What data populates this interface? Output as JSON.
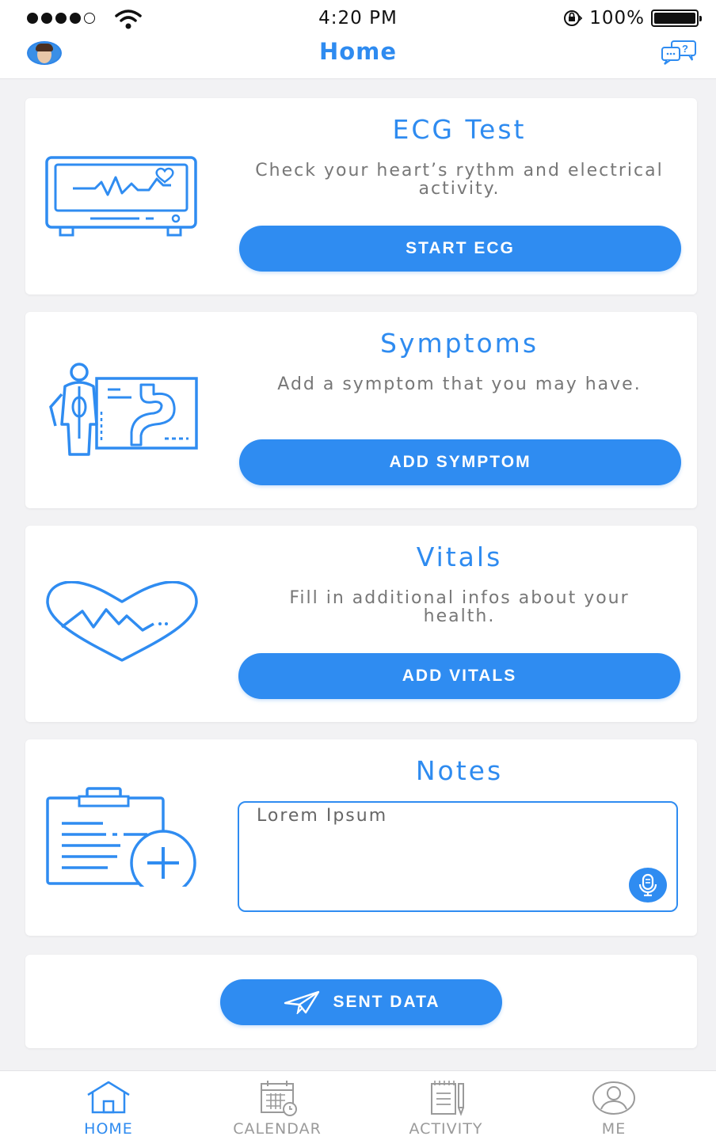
{
  "status_bar": {
    "time": "4:20 PM",
    "battery": "100%",
    "signal_bars": 4,
    "icons": [
      "signal-icon",
      "wifi-icon",
      "rotation-lock-icon",
      "battery-icon"
    ]
  },
  "nav": {
    "title": "Home",
    "left_icon": "avatar",
    "right_icon": "help-chat-icon"
  },
  "cards": [
    {
      "icon": "ecg-monitor-icon",
      "title": "ECG Test",
      "description": "Check your heart’s rythm and electrical activity.",
      "button": "START ECG"
    },
    {
      "icon": "symptoms-body-icon",
      "title": "Symptoms",
      "description": "Add a symptom that you may have.",
      "button": "ADD SYMPTOM"
    },
    {
      "icon": "vitals-heart-icon",
      "title": "Vitals",
      "description": "Fill in additional infos about your health.",
      "button": "ADD VITALS"
    }
  ],
  "notes": {
    "icon": "clipboard-add-icon",
    "title": "Notes",
    "text": "Lorem Ipsum",
    "mic_icon": "microphone-icon"
  },
  "send": {
    "icon": "paper-plane-icon",
    "label": "SENT DATA"
  },
  "tabs": [
    {
      "label": "HOME",
      "icon": "home-icon",
      "active": true
    },
    {
      "label": "CALENDAR",
      "icon": "calendar-icon",
      "active": false
    },
    {
      "label": "ACTIVITY",
      "icon": "activity-icon",
      "active": false
    },
    {
      "label": "ME",
      "icon": "user-icon",
      "active": false
    }
  ],
  "colors": {
    "accent": "#2f8cf1",
    "title_blue": "#2e8bf0",
    "background": "#f2f2f4",
    "inactive_tab": "#9a9a9a"
  }
}
